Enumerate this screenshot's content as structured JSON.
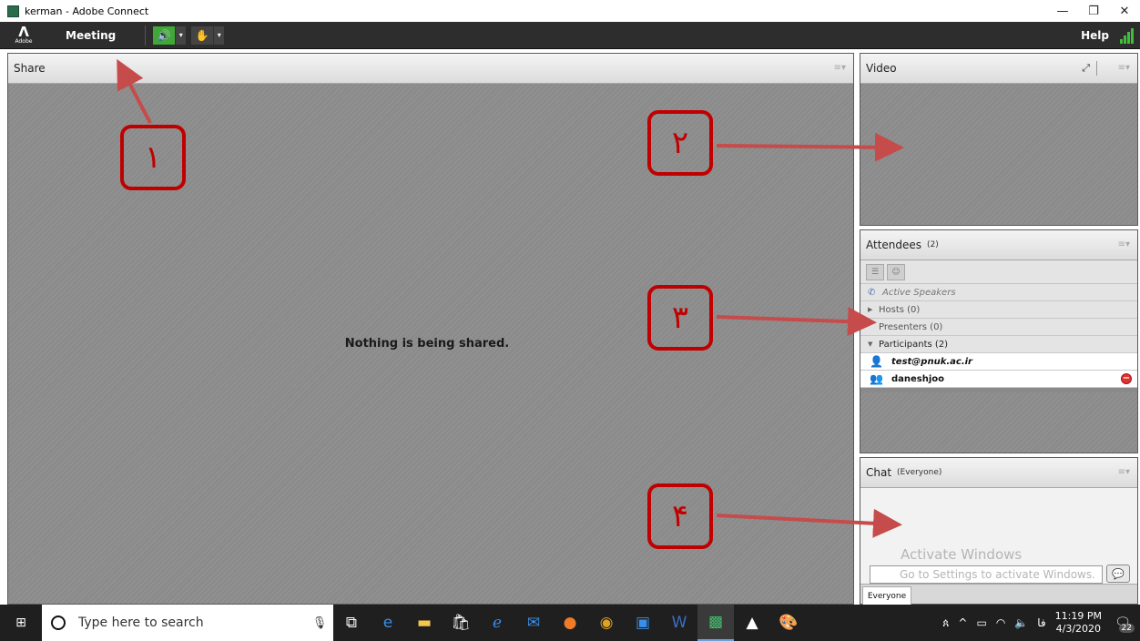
{
  "window": {
    "title": "kerman - Adobe Connect",
    "controls": [
      "—",
      "❐",
      "✕"
    ]
  },
  "menubar": {
    "logo_text": "Adobe",
    "meeting_label": "Meeting",
    "help_label": "Help"
  },
  "share": {
    "title": "Share",
    "message": "Nothing is being shared."
  },
  "video": {
    "title": "Video"
  },
  "attendees": {
    "title": "Attendees",
    "count": "(2)",
    "active_speakers": "Active Speakers",
    "hosts": "Hosts (0)",
    "presenters": "Presenters (0)",
    "participants": "Participants (2)",
    "users": [
      {
        "name": "test@pnuk.ac.ir"
      },
      {
        "name": "daneshjoo"
      }
    ]
  },
  "chat": {
    "title": "Chat",
    "scope": "(Everyone)",
    "watermark_line1": "Activate Windows",
    "input_text": "Go to Settings to activate Windows.",
    "tab_label": "Everyone"
  },
  "callouts": [
    "١",
    "٢",
    "٣",
    "۴"
  ],
  "taskbar": {
    "search_placeholder": "Type here to search",
    "tray_lang": "فا",
    "time": "11:19 PM",
    "date": "4/3/2020",
    "notification_count": "22"
  },
  "colors": {
    "callout": "#c00000",
    "arrow": "#c64b4b",
    "audio_active": "#3fa837"
  }
}
